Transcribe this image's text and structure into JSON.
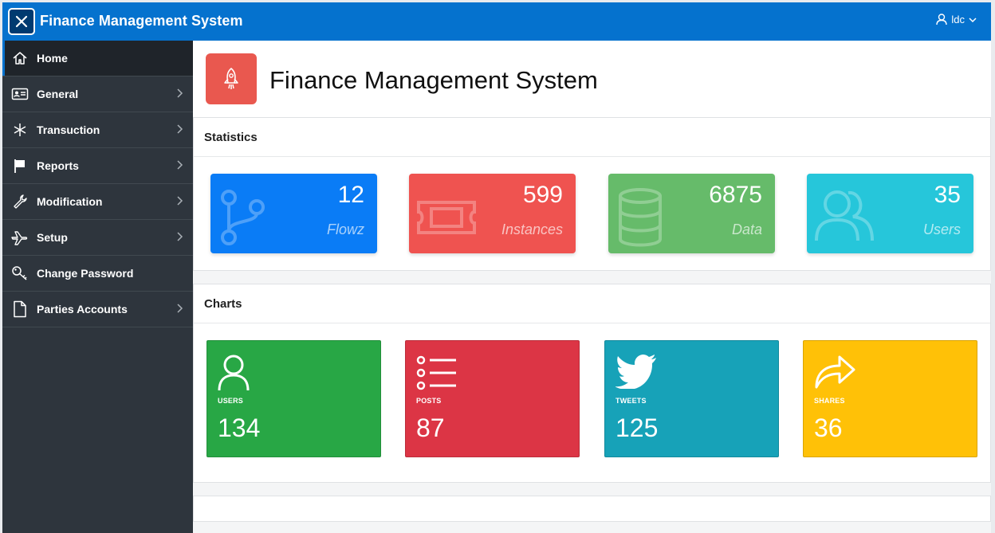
{
  "app": {
    "title": "Finance Management System",
    "user": "ldc"
  },
  "sidebar": {
    "items": [
      {
        "label": "Home",
        "icon": "home-icon",
        "has_submenu": false
      },
      {
        "label": "General",
        "icon": "id-card-icon",
        "has_submenu": true
      },
      {
        "label": "Transuction",
        "icon": "asterisk-icon",
        "has_submenu": true
      },
      {
        "label": "Reports",
        "icon": "flag-icon",
        "has_submenu": true
      },
      {
        "label": "Modification",
        "icon": "wrench-icon",
        "has_submenu": true
      },
      {
        "label": "Setup",
        "icon": "plane-icon",
        "has_submenu": true
      },
      {
        "label": "Change Password",
        "icon": "key-icon",
        "has_submenu": false
      },
      {
        "label": "Parties Accounts",
        "icon": "file-icon",
        "has_submenu": true
      }
    ]
  },
  "page": {
    "title": "Finance Management System"
  },
  "statistics": {
    "title": "Statistics",
    "cards": [
      {
        "value": "12",
        "label": "Flowz",
        "icon": "branch-icon",
        "color": "#0a7cf6"
      },
      {
        "value": "599",
        "label": "Instances",
        "icon": "ticket-icon",
        "color": "#ef5350"
      },
      {
        "value": "6875",
        "label": "Data",
        "icon": "database-icon",
        "color": "#66bb6a"
      },
      {
        "value": "35",
        "label": "Users",
        "icon": "users-icon",
        "color": "#26c6da"
      }
    ]
  },
  "charts": {
    "title": "Charts",
    "cards": [
      {
        "label": "USERS",
        "value": "134",
        "icon": "user-icon",
        "color": "#28a745"
      },
      {
        "label": "POSTS",
        "value": "87",
        "icon": "list-icon",
        "color": "#dc3545"
      },
      {
        "label": "TWEETS",
        "value": "125",
        "icon": "twitter-icon",
        "color": "#17a2b8"
      },
      {
        "label": "SHARES",
        "value": "36",
        "icon": "share-icon",
        "color": "#ffc107"
      }
    ]
  }
}
